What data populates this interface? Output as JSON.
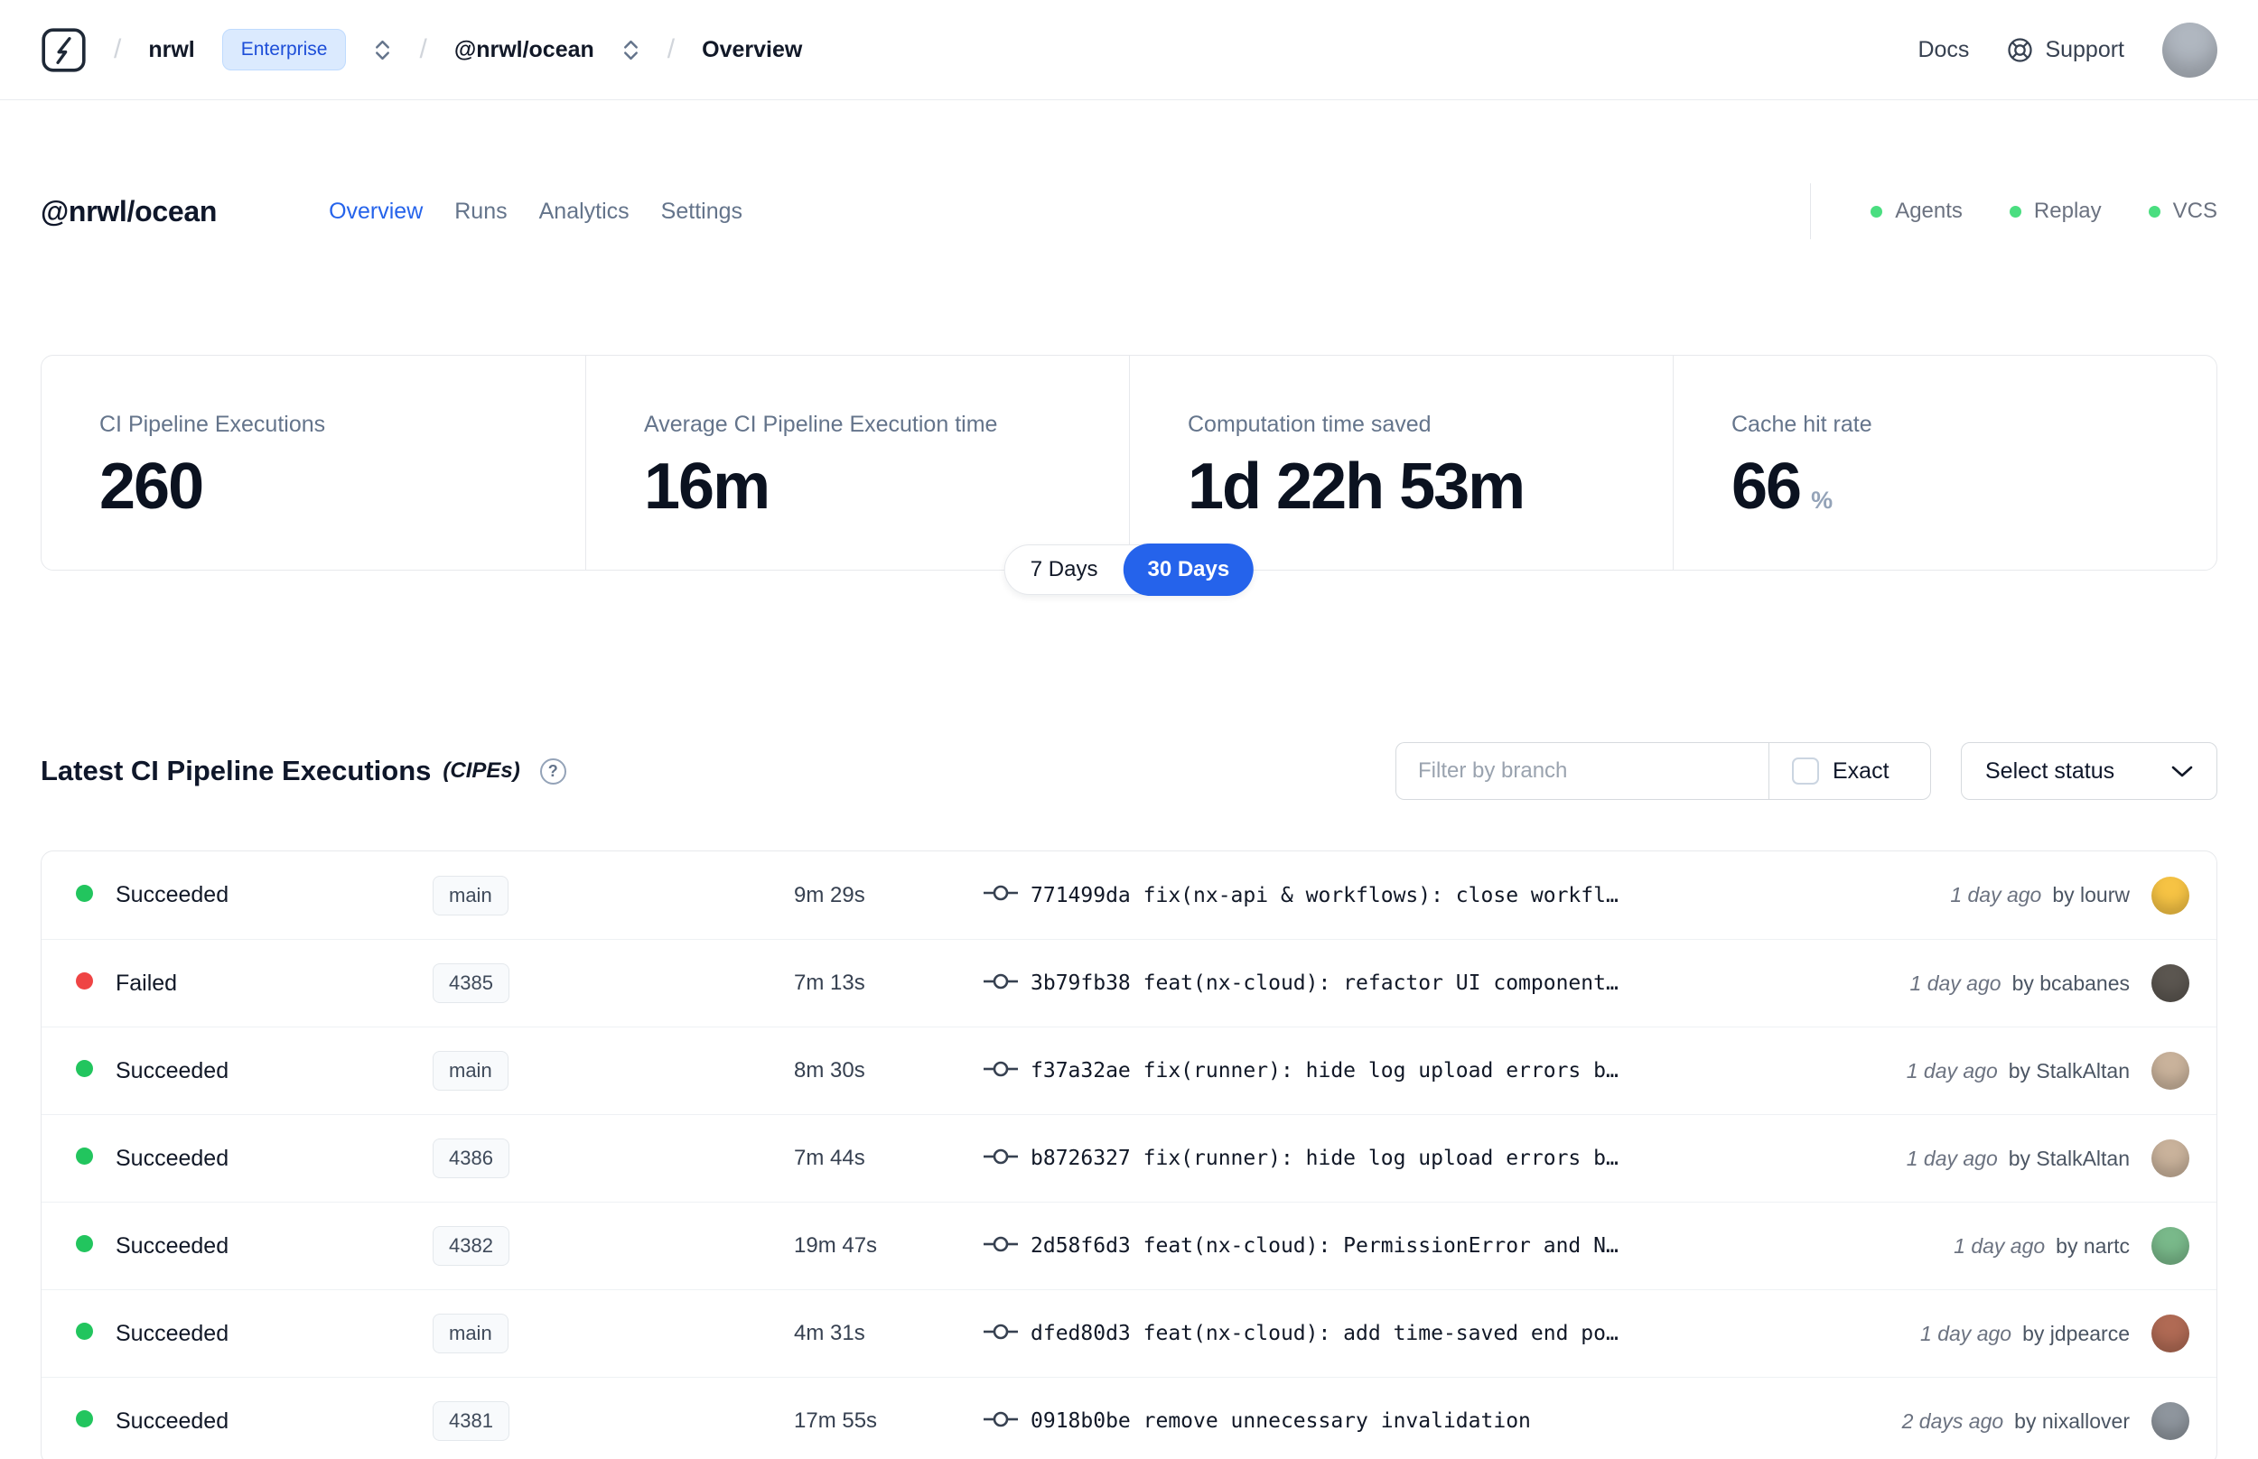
{
  "colors": {
    "accent": "#2563eb",
    "success": "#22c55e",
    "danger": "#ef4444",
    "status_dot_green": "#4ade80"
  },
  "icons": {
    "breadcrumb_separator": "/",
    "help_glyph": "?"
  },
  "topbar": {
    "org": "nrwl",
    "org_badge": "Enterprise",
    "workspace": "@nrwl/ocean",
    "page": "Overview",
    "docs_label": "Docs",
    "support_label": "Support",
    "avatar_color": "#b0b7c0"
  },
  "header": {
    "title": "@nrwl/ocean",
    "tabs": [
      {
        "label": "Overview",
        "active": true
      },
      {
        "label": "Runs",
        "active": false
      },
      {
        "label": "Analytics",
        "active": false
      },
      {
        "label": "Settings",
        "active": false
      }
    ],
    "statuses": [
      {
        "label": "Agents"
      },
      {
        "label": "Replay"
      },
      {
        "label": "VCS"
      }
    ]
  },
  "stats": {
    "cards": [
      {
        "title": "CI Pipeline Executions",
        "value": "260",
        "suffix": ""
      },
      {
        "title": "Average CI Pipeline Execution time",
        "value": "16m",
        "suffix": ""
      },
      {
        "title": "Computation time saved",
        "value": "1d 22h 53m",
        "suffix": ""
      },
      {
        "title": "Cache hit rate",
        "value": "66",
        "suffix": "%"
      }
    ],
    "range_toggle": {
      "options": [
        "7 Days",
        "30 Days"
      ],
      "active": "30 Days"
    }
  },
  "cipes": {
    "title": "Latest CI Pipeline Executions",
    "title_suffix": "(CIPEs)",
    "filter_placeholder": "Filter by branch",
    "exact_label": "Exact",
    "status_select_label": "Select status",
    "rows": [
      {
        "status": "Succeeded",
        "branch": "main",
        "duration": "9m 29s",
        "commit": "771499da fix(nx-api & workflows): close workfl…",
        "time": "1 day ago",
        "author": "by lourw",
        "avatar_color": "#f6c344"
      },
      {
        "status": "Failed",
        "branch": "4385",
        "duration": "7m 13s",
        "commit": "3b79fb38 feat(nx-cloud): refactor UI component…",
        "time": "1 day ago",
        "author": "by bcabanes",
        "avatar_color": "#5b5650"
      },
      {
        "status": "Succeeded",
        "branch": "main",
        "duration": "8m 30s",
        "commit": "f37a32ae fix(runner): hide log upload errors b…",
        "time": "1 day ago",
        "author": "by StalkAltan",
        "avatar_color": "#c9b29b"
      },
      {
        "status": "Succeeded",
        "branch": "4386",
        "duration": "7m 44s",
        "commit": "b8726327 fix(runner): hide log upload errors b…",
        "time": "1 day ago",
        "author": "by StalkAltan",
        "avatar_color": "#c9b29b"
      },
      {
        "status": "Succeeded",
        "branch": "4382",
        "duration": "19m 47s",
        "commit": "2d58f6d3 feat(nx-cloud): PermissionError and N…",
        "time": "1 day ago",
        "author": "by nartc",
        "avatar_color": "#79b98a"
      },
      {
        "status": "Succeeded",
        "branch": "main",
        "duration": "4m 31s",
        "commit": "dfed80d3 feat(nx-cloud): add time-saved end po…",
        "time": "1 day ago",
        "author": "by jdpearce",
        "avatar_color": "#b06a54"
      },
      {
        "status": "Succeeded",
        "branch": "4381",
        "duration": "17m 55s",
        "commit": "0918b0be remove unnecessary invalidation",
        "time": "2 days ago",
        "author": "by nixallover",
        "avatar_color": "#8e959d"
      }
    ]
  }
}
